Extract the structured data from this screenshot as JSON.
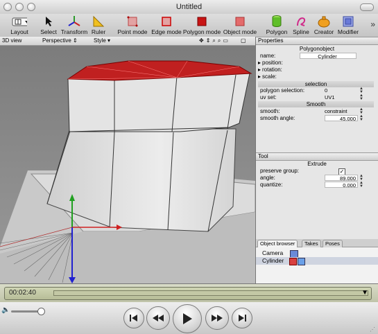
{
  "window": {
    "title": "Untitled"
  },
  "toolbar": {
    "layout": "Layout",
    "select": "Select",
    "transform": "Transform",
    "ruler": "Ruler",
    "point_mode": "Point mode",
    "edge_mode": "Edge mode",
    "polygon_mode": "Polygon mode",
    "object_mode": "Object mode",
    "polygon": "Polygon",
    "spline": "Spline",
    "creator": "Creator",
    "modifier": "Modifier",
    "overflow": "»"
  },
  "viewport": {
    "label": "3D view",
    "camera": "Perspective",
    "style": "Style"
  },
  "properties": {
    "header": "Properties",
    "title": "Polygonobject",
    "name_label": "name:",
    "name_value": "Cylinder",
    "position_label": "position:",
    "rotation_label": "rotation:",
    "scale_label": "scale:",
    "selection_header": "selection",
    "poly_sel_label": "polygon selection:",
    "poly_sel_value": "0",
    "uvset_label": "uv set:",
    "uvset_value": "UV1",
    "smooth_header": "Smooth",
    "smooth_label": "smooth:",
    "smooth_value": "constraint",
    "angle_label": "smooth angle:",
    "angle_value": "45.000"
  },
  "tool": {
    "header": "Tool",
    "title": "Extrude",
    "preserve_label": "preserve group:",
    "preserve_checked": true,
    "angle_label": "angle:",
    "angle_value": "89.000",
    "quantize_label": "quantize:",
    "quantize_value": "0.000"
  },
  "browser": {
    "tabs": [
      "Object browser",
      "Takes",
      "Poses"
    ],
    "objects": [
      "Camera",
      "Cylinder"
    ]
  },
  "timeline": {
    "time": "00:02:40"
  }
}
